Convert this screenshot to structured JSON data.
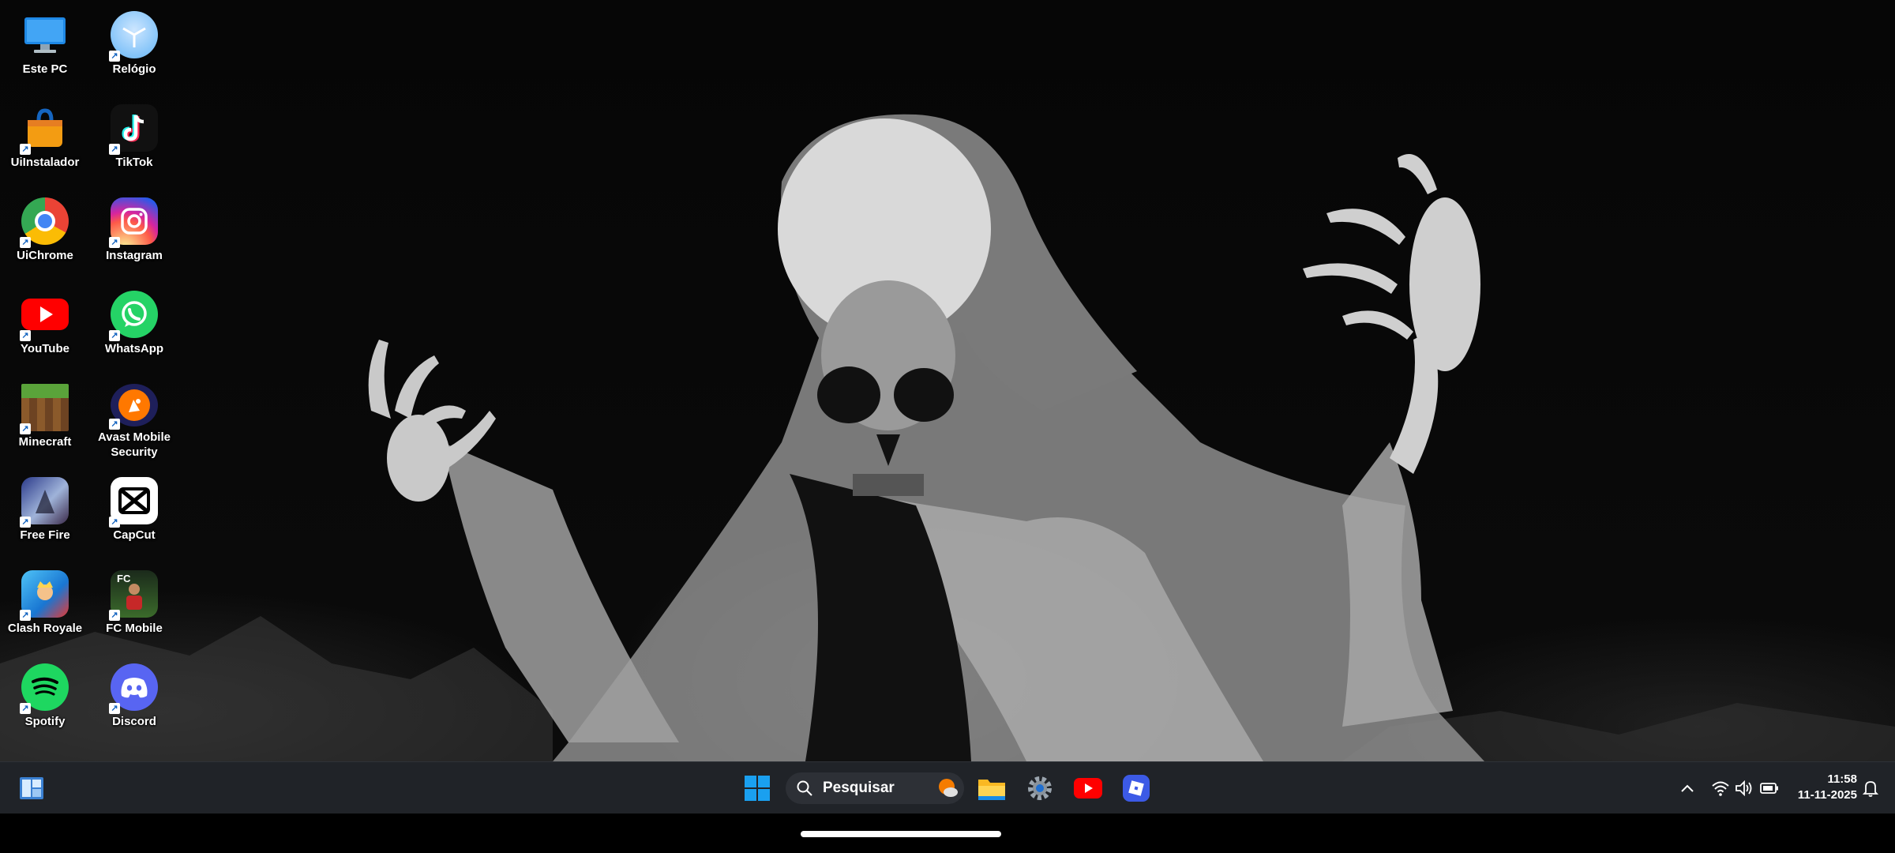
{
  "desktop": {
    "icons": [
      {
        "label": "Este PC",
        "icon": "monitor-icon"
      },
      {
        "label": "Relógio",
        "icon": "clock-icon"
      },
      {
        "label": "UiInstalador",
        "icon": "installer-icon"
      },
      {
        "label": "TikTok",
        "icon": "tiktok-icon"
      },
      {
        "label": "UiChrome",
        "icon": "chrome-icon"
      },
      {
        "label": "Instagram",
        "icon": "instagram-icon"
      },
      {
        "label": "YouTube",
        "icon": "youtube-icon"
      },
      {
        "label": "WhatsApp",
        "icon": "whatsapp-icon"
      },
      {
        "label": "Minecraft",
        "icon": "minecraft-icon"
      },
      {
        "label": "Avast Mobile Security",
        "icon": "avast-icon"
      },
      {
        "label": "Free Fire",
        "icon": "free-fire-icon"
      },
      {
        "label": "CapCut",
        "icon": "capcut-icon"
      },
      {
        "label": "Clash Royale",
        "icon": "clash-royale-icon"
      },
      {
        "label": "FC Mobile",
        "icon": "fc-mobile-icon",
        "badge": "FC"
      },
      {
        "label": "Spotify",
        "icon": "spotify-icon"
      },
      {
        "label": "Discord",
        "icon": "discord-icon"
      }
    ]
  },
  "taskbar": {
    "search_label": "Pesquisar",
    "pinned": [
      "file-explorer-icon",
      "settings-icon",
      "youtube-icon",
      "roblox-icon"
    ],
    "clock": {
      "time": "11:58",
      "date": "11-11-2025"
    }
  },
  "colors": {
    "taskbar": "#202328",
    "windows_blue": "#1aa0f0",
    "youtube_red": "#ff0000",
    "discord": "#5865f2",
    "spotify": "#1ed760",
    "whatsapp": "#25d366"
  }
}
